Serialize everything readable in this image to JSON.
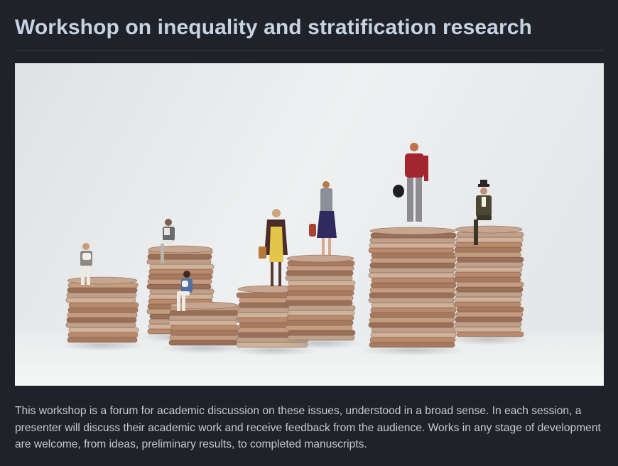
{
  "page": {
    "title": "Workshop on inequality and stratification research",
    "description": "This workshop is a forum for academic discussion on these issues, understood in a broad sense. In each session, a presenter will discuss their academic work and receive feedback from the audience. Works in any stage of development are welcome, from ideas, preliminary results, to completed manuscripts."
  },
  "theme": {
    "background": "#1f2229",
    "title_color": "#c7d3e3",
    "text_color": "#c6c9cf"
  }
}
